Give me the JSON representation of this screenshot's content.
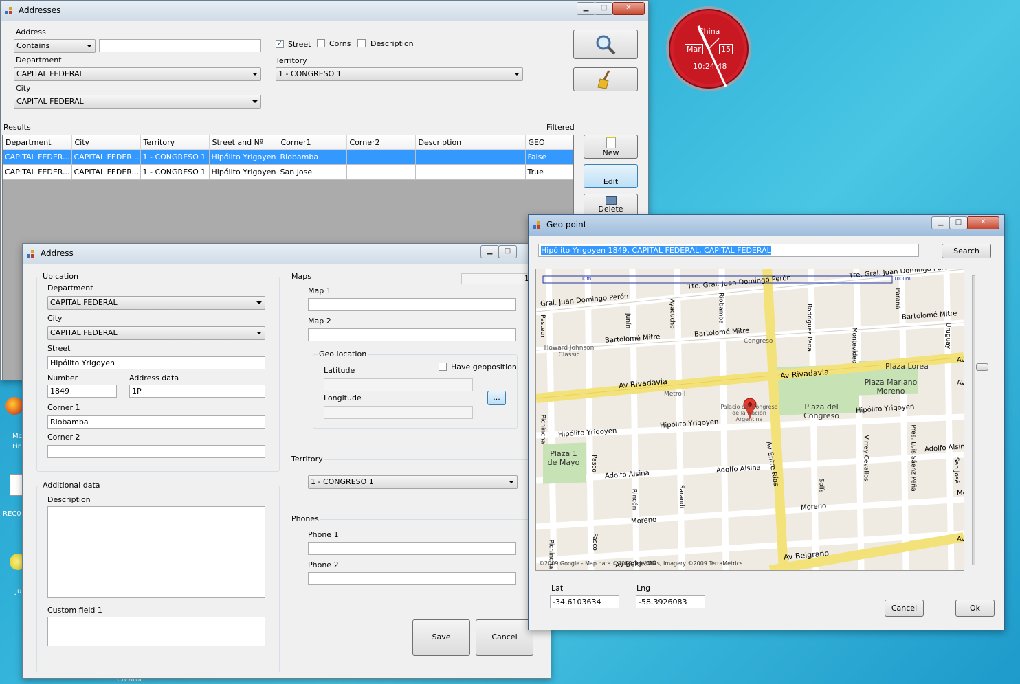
{
  "clock": {
    "city": "China",
    "month": "Mar",
    "day": "15",
    "time": "10:24:48",
    "accent": "#d21f2b"
  },
  "desktop": {
    "icons": [
      {
        "label": "Mc"
      },
      {
        "label": "Fir"
      },
      {
        "label": "REC0"
      },
      {
        "label": "Ju"
      },
      {
        "label": "Creator"
      }
    ]
  },
  "addresses": {
    "title": "Addresses",
    "controls": {
      "min": "▁",
      "max": "□",
      "close": "✕"
    },
    "address_label": "Address",
    "match_mode": "Contains",
    "search_text": "",
    "chk_street": "Street",
    "chk_corns": "Corns",
    "chk_description": "Description",
    "department_label": "Department",
    "department": "CAPITAL FEDERAL",
    "territory_label": "Territory",
    "territory": "1 - CONGRESO 1",
    "city_label": "City",
    "city": "CAPITAL FEDERAL",
    "results_label": "Results",
    "filtered_label": "Filtered",
    "columns": [
      "Department",
      "City",
      "Territory",
      "Street and Nº",
      "Corner1",
      "Corner2",
      "Description",
      "GEO"
    ],
    "rows": [
      [
        "CAPITAL FEDER...",
        "CAPITAL FEDER...",
        "1 - CONGRESO 1",
        "Hipólito Yrigoyen ...",
        "Riobamba",
        "",
        "",
        "False"
      ],
      [
        "CAPITAL FEDER...",
        "CAPITAL FEDER...",
        "1 - CONGRESO 1",
        "Hipólito Yrigoyen ...",
        "San Jose",
        "",
        "",
        "True"
      ]
    ],
    "new_label": "New",
    "edit_label": "Edit",
    "delete_label": "Delete"
  },
  "address": {
    "title": "Address",
    "controls": {
      "min": "▁",
      "max": "□"
    },
    "ubication_label": "Ubication",
    "department_label": "Department",
    "department": "CAPITAL FEDERAL",
    "city_label": "City",
    "city": "CAPITAL FEDERAL",
    "street_label": "Street",
    "street": "Hipólito Yrigoyen",
    "number_label": "Number",
    "number": "1849",
    "address_data_label": "Address data",
    "address_data": "1P",
    "corner1_label": "Corner 1",
    "corner1": "Riobamba",
    "corner2_label": "Corner 2",
    "corner2": "",
    "maps_label": "Maps",
    "maps_counter": "1",
    "map1_label": "Map 1",
    "map2_label": "Map 2",
    "geo_label": "Geo location",
    "have_geo_label": "Have geoposition",
    "latitude_label": "Latitude",
    "longitude_label": "Longitude",
    "geo_button": "...",
    "territory_label": "Territory",
    "territory": "1 - CONGRESO 1",
    "phones_label": "Phones",
    "phone1_label": "Phone 1",
    "phone2_label": "Phone 2",
    "additional_label": "Additional data",
    "description_label": "Description",
    "custom_label": "Custom field 1",
    "save_label": "Save",
    "cancel_label": "Cancel"
  },
  "geopoint": {
    "title": "Geo point",
    "controls": {
      "min": "▁",
      "max": "□",
      "close": "✕"
    },
    "query": "Hipólito Yrigoyen 1849, CAPITAL FEDERAL, CAPITAL FEDERAL",
    "search_label": "Search",
    "scale_label": "100m",
    "scale_label2": "1000m",
    "streets": [
      "Tte. Gral. Juan Domingo Perón",
      "Tte. Gral. Juan Domingo Perón",
      "Gral. Juan Domingo Perón",
      "Bartolomé Mitre",
      "Bartolomé Mitre",
      "Bartolomé Mitre",
      "Av Rivadavia",
      "Av Rivadavia",
      "Hipólito Yrigoyen",
      "Hipólito Yrigoyen",
      "Hipólito Yrigoyen",
      "Adolfo Alsina",
      "Adolfo Alsina",
      "Adolfo Alsina",
      "Moreno",
      "Moreno",
      "Av Belgrano",
      "Av Belgrano",
      "Av Entre Ríos",
      "Pasteur",
      "Junín",
      "Ayacucho",
      "Riobamba",
      "Rodríguez Peña",
      "Montevideo",
      "Paraná",
      "Uruguay",
      "Pichincha",
      "Pasco",
      "Rincón",
      "Sarandí",
      "Solís",
      "Virrey Cevallos",
      "Pres. Luis Sáenz Peña",
      "San José",
      "Pichincha",
      "Pasco",
      "Av",
      "Av",
      "Av",
      "Mo"
    ],
    "places": [
      "Howard Johnson Classic",
      "Congreso",
      "Plaza Lorea",
      "Plaza Mariano Moreno",
      "Plaza del Congreso",
      "Metro I",
      "Palacio del Congreso de la Nación Argentina",
      "Plaza 1 de Mayo"
    ],
    "copyright": "©2009 Google - Map data ©2009 Tele Atlas, Imagery ©2009 TerraMetrics",
    "lat_label": "Lat",
    "lat": "-34.6103634",
    "lng_label": "Lng",
    "lng": "-58.3926083",
    "cancel_label": "Cancel",
    "ok_label": "Ok"
  }
}
